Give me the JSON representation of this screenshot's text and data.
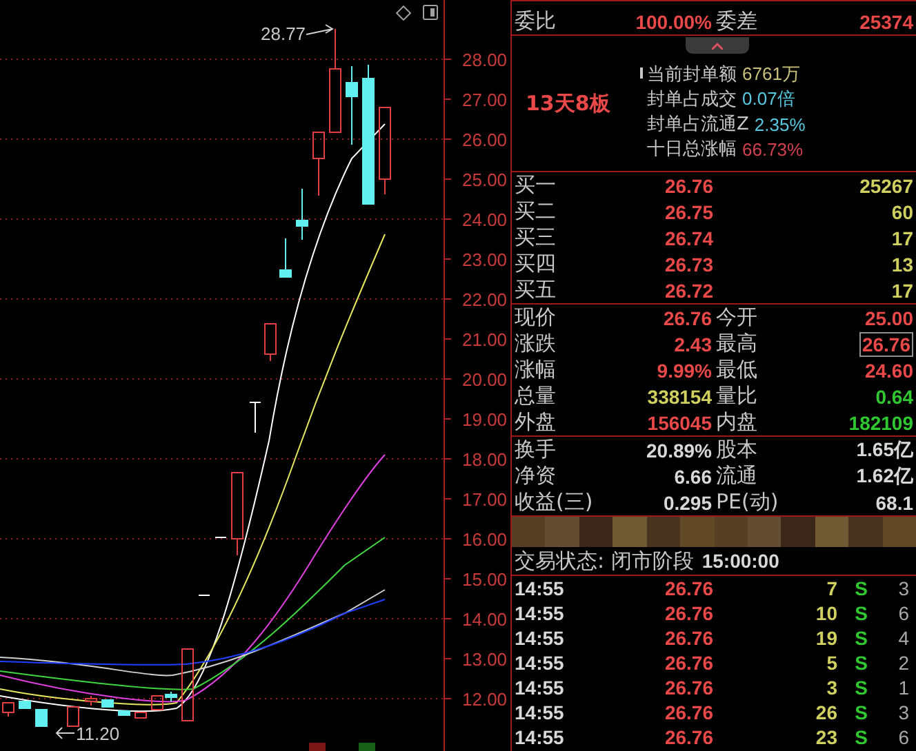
{
  "chart": {
    "y_axis_labels": [
      "28.00",
      "27.00",
      "26.00",
      "25.00",
      "24.00",
      "23.00",
      "22.00",
      "21.00",
      "20.00",
      "19.00",
      "18.00",
      "17.00",
      "16.00",
      "15.00",
      "14.00",
      "13.00",
      "12.00"
    ],
    "high_label": "28.77",
    "low_label": "11.20"
  },
  "ratio_row": {
    "left": {
      "label": "委比",
      "value": "100.00%",
      "color": "#e84848"
    },
    "right": {
      "label": "委差",
      "value": "25374",
      "color": "#e84848"
    }
  },
  "seal_info": {
    "badge": "13天8板",
    "lines": [
      {
        "label": "当前封单额",
        "value": "6761万",
        "color": "#c8c078"
      },
      {
        "label": "封单占成交",
        "value": "0.07倍",
        "color": "#58c8e0"
      },
      {
        "label": "封单占流通Z",
        "value": "2.35%",
        "color": "#58c8e0"
      },
      {
        "label": "十日总涨幅",
        "value": "66.73%",
        "color": "#d04050"
      }
    ]
  },
  "bids": [
    {
      "label": "买一",
      "price": "26.76",
      "volume": "25267"
    },
    {
      "label": "买二",
      "price": "26.75",
      "volume": "60"
    },
    {
      "label": "买三",
      "price": "26.74",
      "volume": "17"
    },
    {
      "label": "买四",
      "price": "26.73",
      "volume": "13"
    },
    {
      "label": "买五",
      "price": "26.72",
      "volume": "17"
    }
  ],
  "quote_rows": [
    {
      "left": {
        "label": "现价",
        "value": "26.76",
        "color": "#e84848",
        "highlighted": false
      },
      "right": {
        "label": "今开",
        "value": "25.00",
        "color": "#e84848",
        "highlighted": false
      }
    },
    {
      "left": {
        "label": "涨跌",
        "value": "2.43",
        "color": "#e84848",
        "highlighted": false
      },
      "right": {
        "label": "最高",
        "value": "26.76",
        "color": "#e84848",
        "highlighted": true
      }
    },
    {
      "left": {
        "label": "涨幅",
        "value": "9.99%",
        "color": "#e84848",
        "highlighted": false
      },
      "right": {
        "label": "最低",
        "value": "24.60",
        "color": "#e84848",
        "highlighted": false
      }
    },
    {
      "left": {
        "label": "总量",
        "value": "338154",
        "color": "#d0d060",
        "highlighted": false
      },
      "right": {
        "label": "量比",
        "value": "0.64",
        "color": "#30c830",
        "highlighted": false
      }
    },
    {
      "left": {
        "label": "外盘",
        "value": "156045",
        "color": "#e84848",
        "highlighted": false
      },
      "right": {
        "label": "内盘",
        "value": "182109",
        "color": "#30c830",
        "highlighted": false
      }
    }
  ],
  "stats_rows": [
    {
      "left": {
        "label": "换手",
        "value": "20.89%"
      },
      "right": {
        "label": "股本",
        "value": "1.65亿"
      }
    },
    {
      "left": {
        "label": "净资",
        "value": "6.66"
      },
      "right": {
        "label": "流通",
        "value": "1.62亿"
      }
    },
    {
      "left": {
        "label": "收益(三)",
        "value": "0.295"
      },
      "right": {
        "label": "PE(动)",
        "value": "68.1"
      }
    }
  ],
  "trade_status": {
    "label": "交易状态: 闭市阶段",
    "time": "15:00:00"
  },
  "ticks": [
    {
      "time": "14:55",
      "price": "26.76",
      "volume": "7",
      "side": "S",
      "color": "#30c830",
      "count": "3"
    },
    {
      "time": "14:55",
      "price": "26.76",
      "volume": "10",
      "side": "S",
      "color": "#30c830",
      "count": "6"
    },
    {
      "time": "14:55",
      "price": "26.76",
      "volume": "19",
      "side": "S",
      "color": "#30c830",
      "count": "4"
    },
    {
      "time": "14:55",
      "price": "26.76",
      "volume": "5",
      "side": "S",
      "color": "#30c830",
      "count": "2"
    },
    {
      "time": "14:55",
      "price": "26.76",
      "volume": "3",
      "side": "S",
      "color": "#30c830",
      "count": "1"
    },
    {
      "time": "14:55",
      "price": "26.76",
      "volume": "26",
      "side": "S",
      "color": "#30c830",
      "count": "3"
    },
    {
      "time": "14:55",
      "price": "26.76",
      "volume": "23",
      "side": "S",
      "color": "#30c830",
      "count": "6"
    }
  ]
}
